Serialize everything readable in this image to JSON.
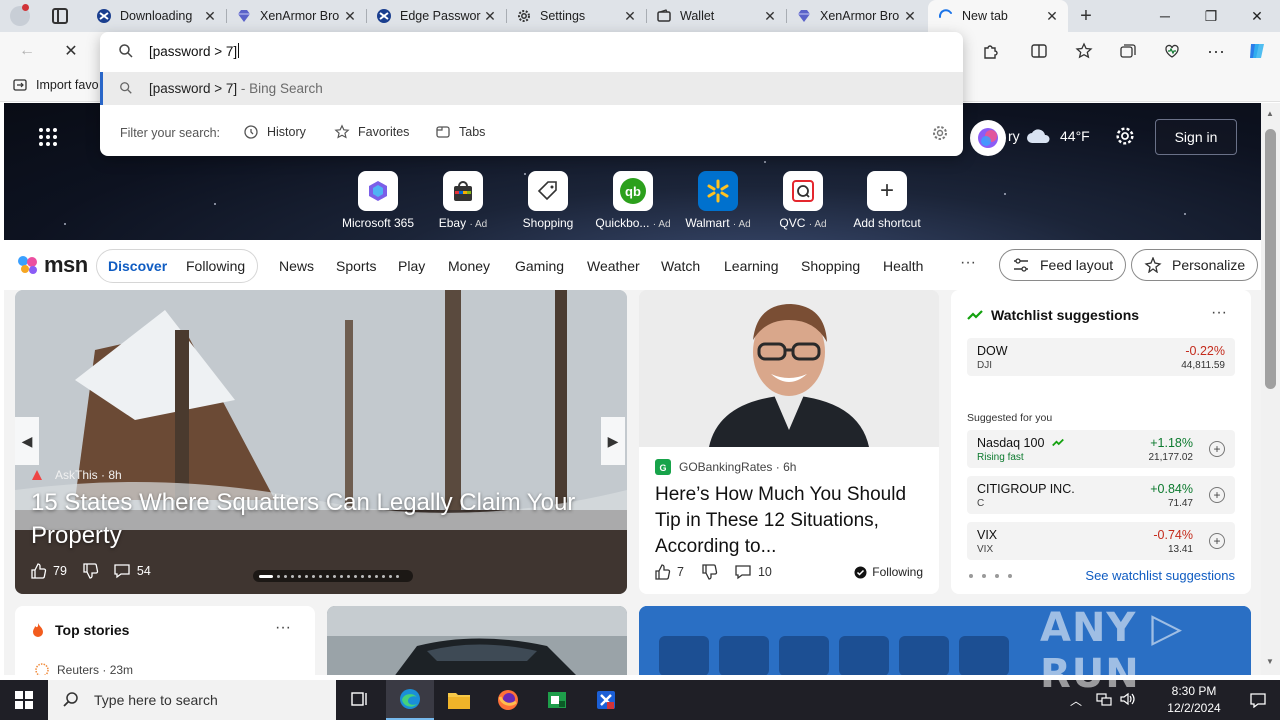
{
  "tabs": [
    {
      "title": "Downloading",
      "icon": "xenarmor-icon"
    },
    {
      "title": "XenArmor Bro",
      "icon": "gem-icon"
    },
    {
      "title": "Edge Passwor",
      "icon": "xenarmor-icon"
    },
    {
      "title": "Settings",
      "icon": "gear-icon"
    },
    {
      "title": "Wallet",
      "icon": "wallet-icon"
    },
    {
      "title": "XenArmor Bro",
      "icon": "gem-icon"
    },
    {
      "title": "New tab",
      "icon": "edge-loading-icon",
      "active": true
    }
  ],
  "favorites_bar": {
    "import_label": "Import favo"
  },
  "omnibox": {
    "typed_text": "[password > 7]",
    "suggestion_text": "[password > 7]",
    "suggestion_suffix": " - Bing Search",
    "filter_label": "Filter your search:",
    "filters": [
      "History",
      "Favorites",
      "Tabs"
    ]
  },
  "hero": {
    "copilot_text": "ry",
    "weather_temp": "44°F",
    "sign_in": "Sign in",
    "tiles": [
      {
        "label": "Microsoft 365",
        "ad": ""
      },
      {
        "label": "Ebay",
        "ad": "· Ad"
      },
      {
        "label": "Shopping",
        "ad": ""
      },
      {
        "label": "Quickbo...",
        "ad": "· Ad"
      },
      {
        "label": "Walmart",
        "ad": "· Ad"
      },
      {
        "label": "QVC",
        "ad": "· Ad"
      },
      {
        "label": "Add shortcut",
        "ad": ""
      }
    ]
  },
  "msn": {
    "logo": "msn",
    "discover": "Discover",
    "following": "Following",
    "nav": [
      "News",
      "Sports",
      "Play",
      "Money",
      "Gaming",
      "Weather",
      "Watch",
      "Learning",
      "Shopping",
      "Health"
    ],
    "more": "···",
    "feed_layout": "Feed layout",
    "personalize": "Personalize"
  },
  "hero_story": {
    "source": "AskThis",
    "age": "· 8h",
    "headline": "15 States Where Squatters Can Legally Claim Your Property",
    "likes": "79",
    "comments": "54"
  },
  "story": {
    "source": "GOBankingRates",
    "age": "· 6h",
    "headline": "Here’s How Much You Should Tip in These 12 Situations, According to...",
    "likes": "7",
    "comments": "10",
    "follow_label": "Following"
  },
  "watchlist": {
    "title": "Watchlist suggestions",
    "more": "···",
    "main": {
      "name": "DOW",
      "symbol": "DJI",
      "change": "-0.22%",
      "value": "44,811.59"
    },
    "suggested_label": "Suggested for you",
    "suggested": [
      {
        "name": "Nasdaq 100",
        "sub": "Rising fast",
        "change": "+1.18%",
        "value": "21,177.02"
      },
      {
        "name": "CITIGROUP INC.",
        "sub": "C",
        "change": "+0.84%",
        "value": "71.47"
      },
      {
        "name": "VIX",
        "sub": "VIX",
        "change": "-0.74%",
        "value": "13.41"
      }
    ],
    "link": "See watchlist suggestions"
  },
  "top_stories": {
    "title": "Top stories",
    "more": "···",
    "source": "Reuters",
    "age": "· 23m"
  },
  "watermark": "ANY ▷ RUN",
  "taskbar": {
    "search_placeholder": "Type here to search",
    "time": "8:30 PM",
    "date": "12/2/2024"
  }
}
